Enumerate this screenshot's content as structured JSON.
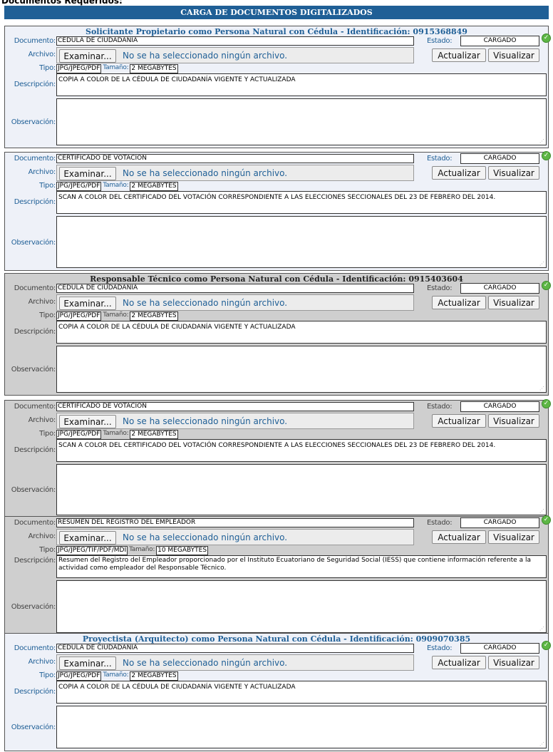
{
  "page": {
    "section_label": "Documentos Requeridos:",
    "header_title": "CARGA DE DOCUMENTOS DIGITALIZADOS"
  },
  "labels": {
    "documento": "Documento:",
    "archivo": "Archivo:",
    "tipo": "Tipo:",
    "tamano": "Tamaño:",
    "descripcion": "Descripción:",
    "observacion": "Observación:",
    "estado": "Estado:",
    "browse_button": "Examinar...",
    "no_file": "No se ha seleccionado ningún archivo.",
    "update_button": "Actualizar",
    "view_button": "Visualizar"
  },
  "panels": [
    {
      "title": "Solicitante Propietario como Persona Natural con Cédula - Identificación: 0915368849",
      "documento": "CÉDULA DE CIUDADANÍA",
      "estado": "CARGADO",
      "tipo": "JPG/JPEG/PDF",
      "tamano": "2 MEGABYTES",
      "descripcion": "COPIA A COLOR DE LA CÉDULA DE CIUDADANÍA VIGENTE Y ACTUALIZADA",
      "observacion": ""
    },
    {
      "title": "",
      "documento": "CERTIFICADO DE VOTACIÓN",
      "estado": "CARGADO",
      "tipo": "JPG/JPEG/PDF",
      "tamano": "2 MEGABYTES",
      "descripcion": "SCAN A COLOR DEL CERTIFICADO DEL VOTACIÓN CORRESPONDIENTE A LAS ELECCIONES SECCIONALES DEL 23 DE FEBRERO DEL 2014.",
      "observacion": ""
    },
    {
      "title": "Responsable Técnico como Persona Natural con Cédula - Identificación: 0915403604",
      "documento": "CÉDULA DE CIUDADANÍA",
      "estado": "CARGADO",
      "tipo": "JPG/JPEG/PDF",
      "tamano": "2 MEGABYTES",
      "descripcion": "COPIA A COLOR DE LA CÉDULA DE CIUDADANÍA VIGENTE Y ACTUALIZADA",
      "observacion": ""
    },
    {
      "title": "",
      "documento": "CERTIFICADO DE VOTACIÓN",
      "estado": "CARGADO",
      "tipo": "JPG/JPEG/PDF",
      "tamano": "2 MEGABYTES",
      "descripcion": "SCAN A COLOR DEL CERTIFICADO DEL VOTACIÓN CORRESPONDIENTE A LAS ELECCIONES SECCIONALES DEL 23 DE FEBRERO DEL 2014.",
      "observacion": ""
    },
    {
      "title": "",
      "documento": "RESUMEN DEL REGISTRO DEL EMPLEADOR",
      "estado": "CARGADO",
      "tipo": "JPG/JPEG/TIF/PDF/MDI",
      "tamano": "10 MEGABYTES",
      "descripcion": "Resumen del Registro del Empleador proporcionado por el Instituto Ecuatoriano de Seguridad Social (IESS) que contiene información referente a la actividad como empleador del Responsable Técnico.",
      "observacion": ""
    },
    {
      "title": "Proyectista (Arquitecto) como Persona Natural con Cédula - Identificación: 0909070385",
      "documento": "CÉDULA DE CIUDADANÍA",
      "estado": "CARGADO",
      "tipo": "JPG/JPEG/PDF",
      "tamano": "2 MEGABYTES",
      "descripcion": "COPIA A COLOR DE LA CÉDULA DE CIUDADANÍA VIGENTE Y ACTUALIZADA",
      "observacion": ""
    }
  ],
  "colors": {
    "header_bg": "#1f5f96",
    "panel_white": "#eef1f8",
    "panel_grey": "#cfcfcf",
    "check_green": "#5db645"
  }
}
